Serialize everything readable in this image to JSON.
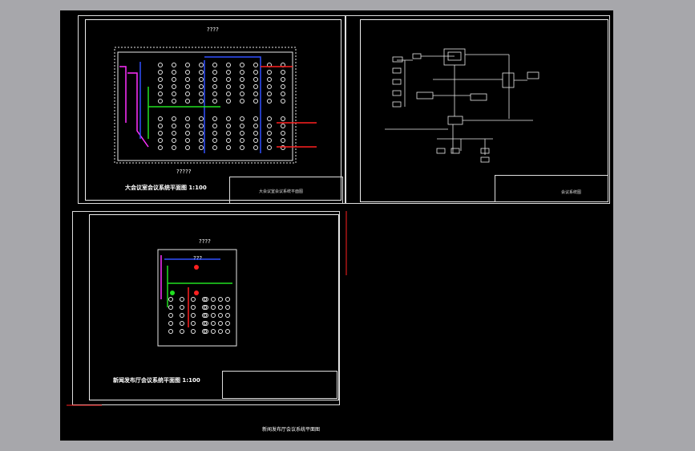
{
  "sheets": {
    "plan_a": {
      "title": "大会议室会议系统平面图 1:100",
      "top_note": "????",
      "bottom_note": "?????",
      "tb_name": "大会议室会议系统平面图"
    },
    "schematic": {
      "tb_name": "会议系统图"
    },
    "plan_b": {
      "title": "新闻发布厅会议系统平面图 1:100",
      "top_note": "????",
      "inner_note": "???",
      "tb_name": "新闻发布厅会议系统平面图"
    }
  },
  "colors": {
    "background": "#a7a7ab",
    "canvas": "#000000",
    "line": "#e8e8e8",
    "red": "#ff2020",
    "blue": "#3050ff",
    "green": "#20e020",
    "magenta": "#ff30ff"
  }
}
